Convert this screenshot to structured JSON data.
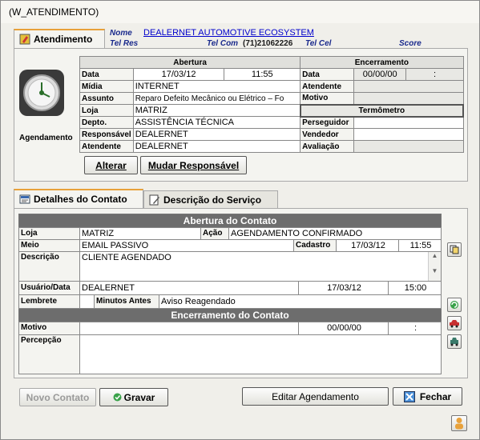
{
  "window": {
    "title": "(W_ATENDIMENTO)"
  },
  "header": {
    "name_label": "Nome",
    "name_value": "DEALERNET AUTOMOTIVE ECOSYSTEM",
    "tel_res_label": "Tel Res",
    "tel_com_label": "Tel Com",
    "tel_com_value": "(71)21062226",
    "tel_cel_label": "Tel Cel",
    "score_label": "Score"
  },
  "atendimento_tab": {
    "label": "Atendimento",
    "icon_caption": "Agendamento"
  },
  "abertura": {
    "title": "Abertura",
    "data_label": "Data",
    "data_value": "17/03/12",
    "hora_value": "11:55",
    "midia_label": "Mídia",
    "midia_value": "INTERNET",
    "assunto_label": "Assunto",
    "assunto_value": "Reparo Defeito Mecânico ou Elétrico – Fo",
    "loja_label": "Loja",
    "loja_value": "MATRIZ",
    "depto_label": "Depto.",
    "depto_value": "ASSISTÊNCIA TÉCNICA",
    "responsavel_label": "Responsável",
    "responsavel_value": "DEALERNET",
    "atendente_label": "Atendente",
    "atendente_value": "DEALERNET"
  },
  "encerramento": {
    "title": "Encerramento",
    "data_label": "Data",
    "data_value": "00/00/00",
    "hora_value": ":",
    "atendente_label": "Atendente",
    "motivo_label": "Motivo",
    "termometro_title": "Termômetro",
    "perseguidor_label": "Perseguidor",
    "vendedor_label": "Vendedor",
    "avaliacao_label": "Avaliação"
  },
  "actions_top": {
    "alterar": "Alterar",
    "mudar_responsavel": "Mudar Responsável"
  },
  "contact_tabs": {
    "detalhes": "Detalhes do Contato",
    "descricao": "Descrição do Serviço"
  },
  "contato": {
    "abertura_title": "Abertura do Contato",
    "loja_label": "Loja",
    "loja_value": "MATRIZ",
    "acao_label": "Ação",
    "acao_value": "AGENDAMENTO CONFIRMADO",
    "meio_label": "Meio",
    "meio_value": "EMAIL PASSIVO",
    "cadastro_label": "Cadastro",
    "cadastro_date": "17/03/12",
    "cadastro_time": "11:55",
    "descricao_label": "Descrição",
    "descricao_value": "CLIENTE AGENDADO",
    "usuario_label": "Usuário/Data",
    "usuario_value": "DEALERNET",
    "usuario_date": "17/03/12",
    "usuario_time": "15:00",
    "lembrete_label": "Lembrete",
    "minutos_label": "Minutos Antes",
    "minutos_value": "Aviso Reagendado",
    "encerramento_title": "Encerramento do Contato",
    "motivo_label": "Motivo",
    "motivo_date": "00/00/00",
    "motivo_time": ":",
    "percepcao_label": "Percepção"
  },
  "bottom_buttons": {
    "novo_contato": "Novo Contato",
    "gravar": "Gravar",
    "editar_agendamento": "Editar Agendamento",
    "fechar": "Fechar"
  }
}
